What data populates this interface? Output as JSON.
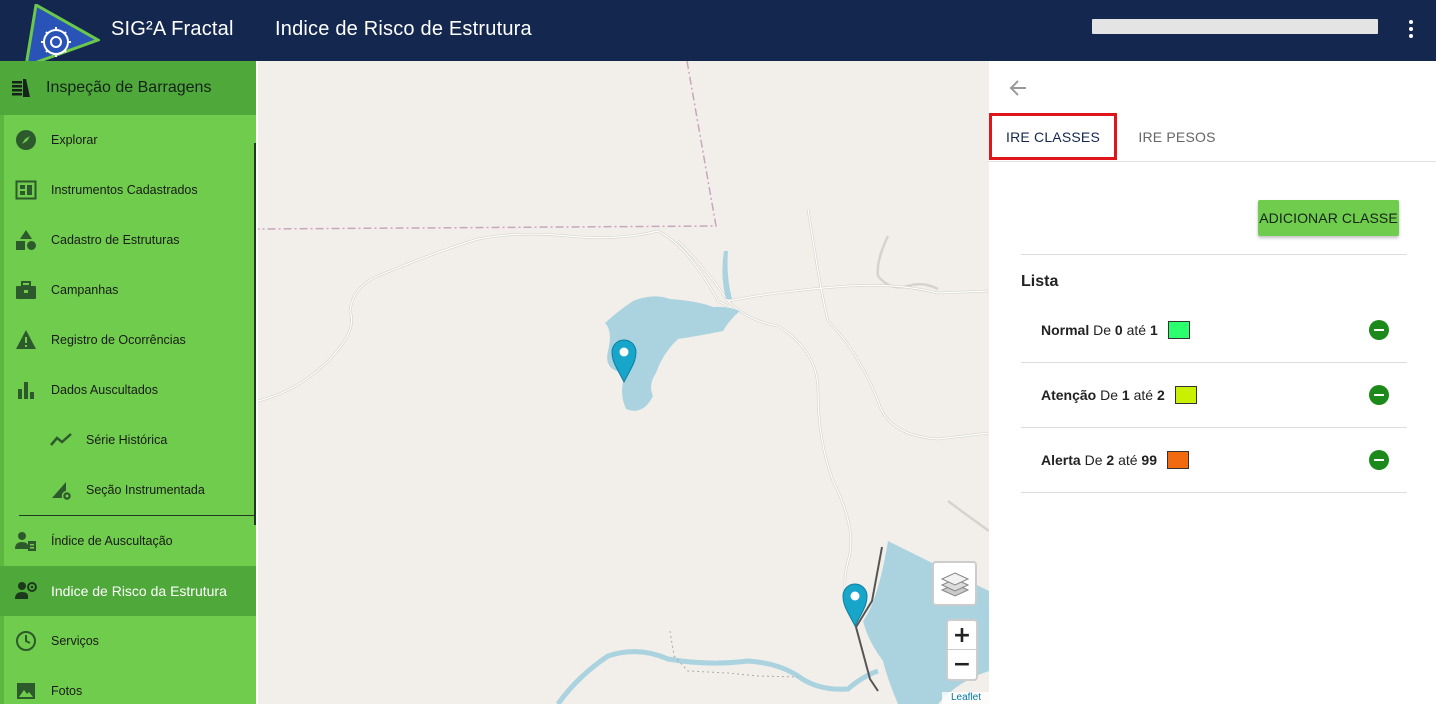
{
  "header": {
    "app_title": "SIG²A Fractal",
    "page_title": "Indice de Risco de Estrutura",
    "menu_icon": "kebab-menu-icon"
  },
  "sidebar": {
    "section_title": "Inspeção de Barragens",
    "items": [
      {
        "label": "Explorar",
        "icon": "compass-icon"
      },
      {
        "label": "Instrumentos Cadastrados",
        "icon": "dashboard-icon"
      },
      {
        "label": "Cadastro de Estruturas",
        "icon": "shapes-icon"
      },
      {
        "label": "Campanhas",
        "icon": "briefcase-icon"
      },
      {
        "label": "Registro de Ocorrências",
        "icon": "warning-icon"
      },
      {
        "label": "Dados Auscultados",
        "icon": "bar-chart-icon"
      },
      {
        "label": "Série Histórica",
        "icon": "trend-line-icon"
      },
      {
        "label": "Seção Instrumentada",
        "icon": "ruler-gear-icon"
      },
      {
        "label": "Índice de Auscultação",
        "icon": "engineer-clipboard-icon"
      },
      {
        "label": "Indice de Risco da Estrutura",
        "icon": "engineer-settings-icon",
        "active": true
      },
      {
        "label": "Serviços",
        "icon": "clock-icon"
      },
      {
        "label": "Fotos",
        "icon": "image-icon"
      }
    ]
  },
  "map": {
    "zoom_in": "+",
    "zoom_out": "−",
    "attribution": "Leaflet"
  },
  "panel": {
    "tabs": [
      {
        "label": "IRE CLASSES",
        "active": true
      },
      {
        "label": "IRE PESOS",
        "active": false
      }
    ],
    "add_button": "ADICIONAR CLASSE",
    "list_title": "Lista",
    "classes": [
      {
        "name": "Normal",
        "de_text": "De",
        "from": "0",
        "ate_text": "até",
        "to": "1",
        "color": "#2bff6e"
      },
      {
        "name": "Atenção",
        "de_text": "De",
        "from": "1",
        "ate_text": "até",
        "to": "2",
        "color": "#c8f000"
      },
      {
        "name": "Alerta",
        "de_text": "De",
        "from": "2",
        "ate_text": "até",
        "to": "99",
        "color": "#f26a0f"
      }
    ]
  }
}
